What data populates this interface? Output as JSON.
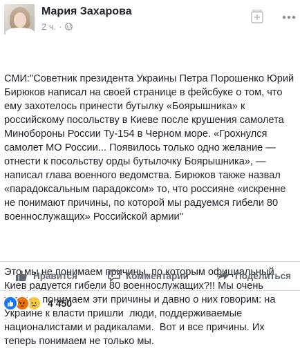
{
  "post": {
    "author": "Мария Захарова",
    "time": "2 ч.",
    "dot": "·",
    "paragraph1": "СМИ:\"Советник президента Украины Петра Порошенко Юрий Бирюков написал на своей странице в фейсбуке о том, что ему захотелось принести бутылку «Боярышника» к российскому посольству в Киеве после крушения самолета Минобороны России Ту-154 в Черном море. «Грохнулся самолет МО России... Появилось только одно желание — отнести к посольству орды бутылочку Боярышника», — написал глава военного ведомства. Бирюков также назвал «парадоксальным парадоксом» то, что россияне «искренне не понимают причины, по которой мы радуемся гибели 80 военнослужащих» Российской армии\"",
    "paragraph2": "Это мы не понимаем причины, по которым официальный Киев радуется гибели 80 военнослужащих?!! Мы очень хорошо понимаем эти причины и давно о них говорим: на Украине к власти пришли  люди, поддерживаемые  националистами и радикалами.  Вот и все причины. Их теперь понимаем не только мы."
  },
  "actions": {
    "like_label": "Нравится",
    "comment_label": "Комментарий",
    "share_label": "Поделиться"
  },
  "reactions": {
    "count": "4 450",
    "types": [
      "like",
      "angry",
      "sad"
    ]
  },
  "colors": {
    "text": "#1d2129",
    "muted": "#90949c",
    "action": "#606770",
    "divider": "#dddfe2"
  },
  "icons": {
    "visibility": "globe-icon",
    "save": "save-icon",
    "more": "more-icon",
    "like": "thumbs-up-icon",
    "comment": "comment-icon",
    "share": "share-icon"
  }
}
